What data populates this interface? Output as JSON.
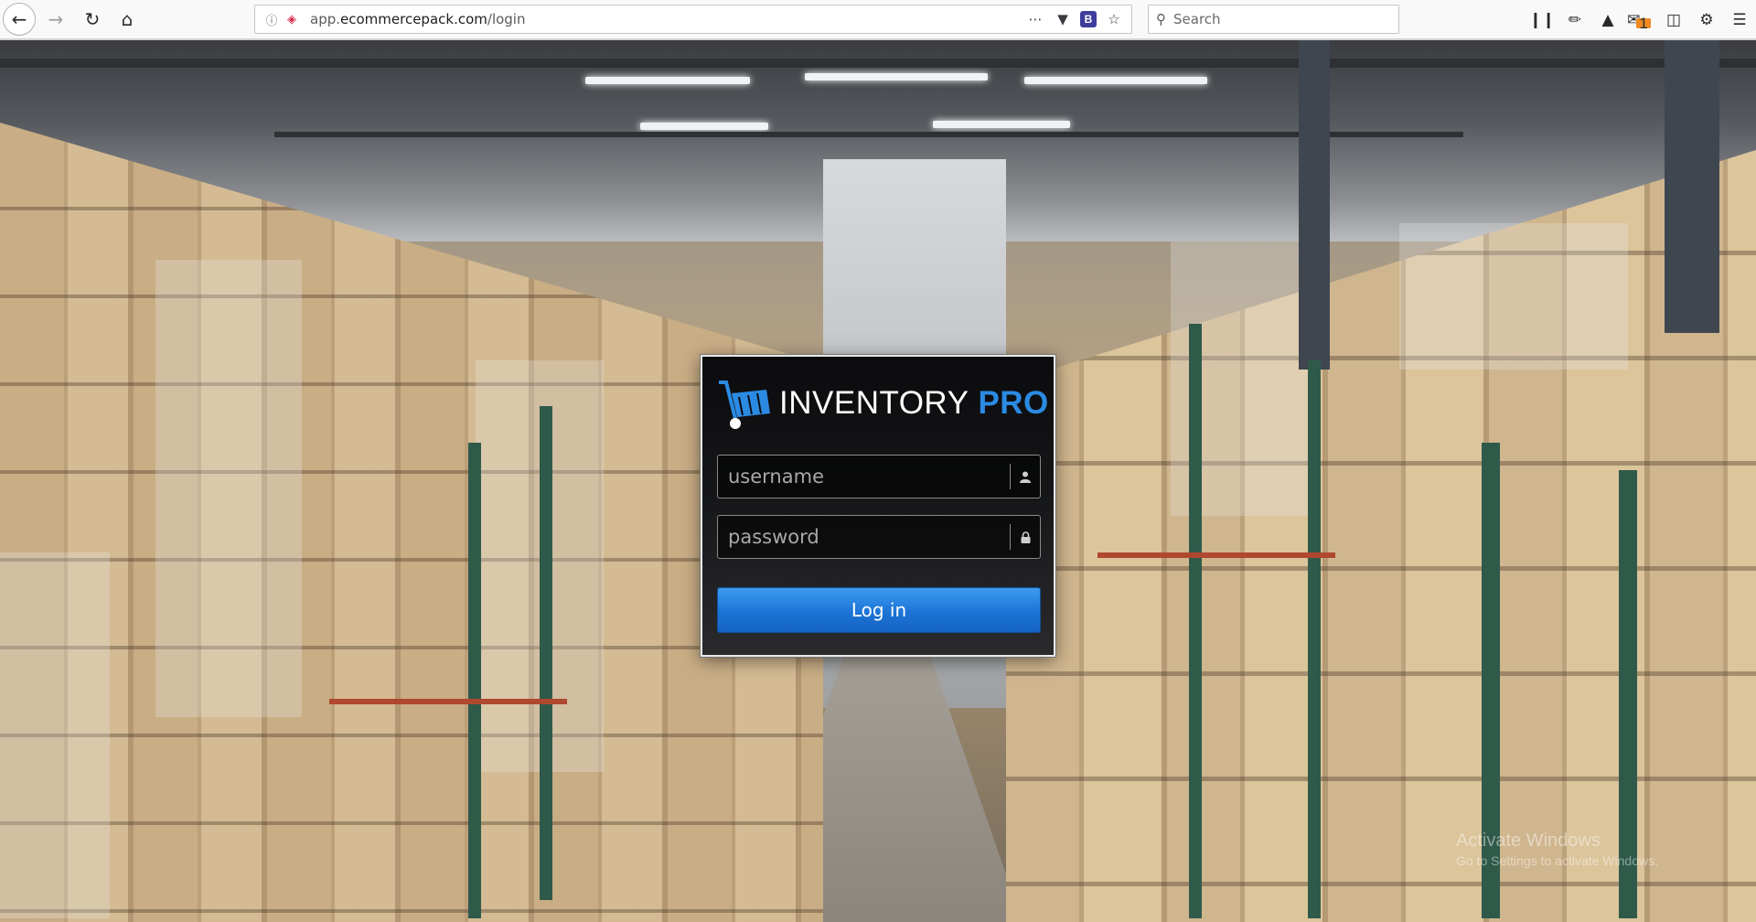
{
  "browser": {
    "url_prefix": "app.",
    "url_domain": "ecommercepack.com",
    "url_path": "/login",
    "search_placeholder": "Search",
    "notification_count": "1",
    "ext_badge": "B",
    "icons": [
      "back-icon",
      "forward-icon",
      "reload-icon",
      "home-icon",
      "info-icon",
      "tracking-shield-icon",
      "more-icon",
      "pocket-icon",
      "bookmark-star-icon",
      "library-icon",
      "eyedropper-icon",
      "extension-icon",
      "notification-icon",
      "sidebar-icon",
      "settings-icon",
      "menu-icon"
    ]
  },
  "login": {
    "brand_main": "INVENTORY",
    "brand_pro": "PRO",
    "username_placeholder": "username",
    "password_placeholder": "password",
    "login_button": "Log in",
    "accent_color": "#2b8ae2",
    "icons": [
      "cart-logo-icon",
      "user-icon",
      "lock-icon"
    ]
  },
  "watermark": {
    "title": "Activate Windows",
    "subtitle": "Go to Settings to activate Windows."
  }
}
